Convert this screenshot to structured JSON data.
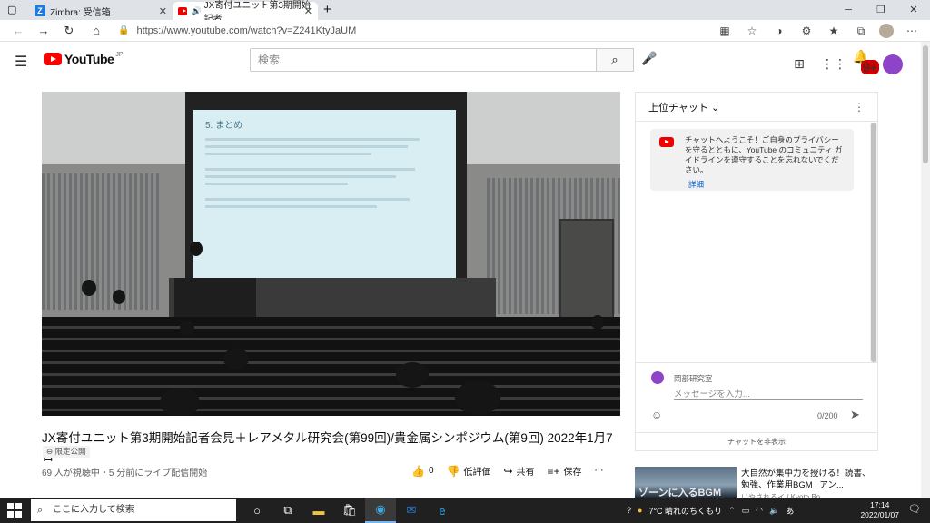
{
  "browser": {
    "tabs": [
      {
        "label": "Zimbra: 受信箱",
        "icon": "zimbra-icon",
        "active": false
      },
      {
        "label": "JX寄付ユニット第3期開始記者",
        "icon": "youtube-icon",
        "active": true
      }
    ],
    "new_tab": "+",
    "url": "https://www.youtube.com/watch?v=Z241KtyJaUM"
  },
  "youtube": {
    "logo_text": "YouTube",
    "region": "JP",
    "search_placeholder": "検索",
    "notifications_badge": "9+"
  },
  "video": {
    "slide_heading": "5. まとめ",
    "title": "JX寄付ユニット第3期開始記者会見＋レアメタル研究会(第99回)/貴金属シンポジウム(第9回) 2022年1月7日",
    "visibility": "限定公開",
    "stats": "69 人が視聴中・5 分前にライブ配信開始",
    "like_count": "0",
    "dislike_label": "低評価",
    "share_label": "共有",
    "save_label": "保存"
  },
  "chat": {
    "header": "上位チャット",
    "welcome": "チャットへようこそ！ご自身のプライバシーを守るとともに、YouTube のコミュニティ ガイドラインを遵守することを忘れないでください。",
    "learn_more": "詳細",
    "user_name": "岡部研究室",
    "input_placeholder": "メッセージを入力...",
    "char_count": "0/200",
    "hide_label": "チャットを非表示"
  },
  "recommendation": {
    "title": "大自然が集中力を授ける！読書、勉強、作業用BGM | アン...",
    "channel": "いやされるイ / Kyoto Bo...",
    "thumb_text": "ゾーンに入るBGM"
  },
  "taskbar": {
    "search_placeholder": "ここに入力して検索",
    "weather": "7°C 晴れのちくもり",
    "ime": "あ",
    "time": "17:14",
    "date": "2022/01/07"
  }
}
